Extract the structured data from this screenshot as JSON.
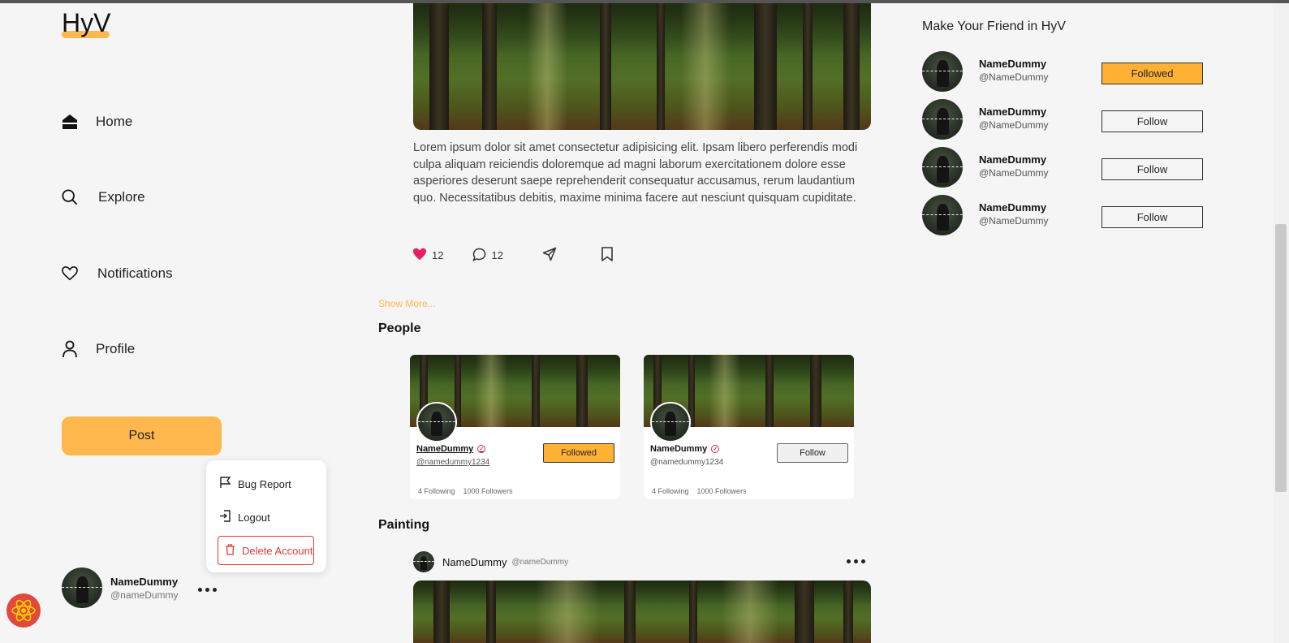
{
  "brand": {
    "logo": "HyV",
    "accent": "#ffb84d"
  },
  "nav": {
    "items": [
      {
        "label": "Home",
        "icon": "home-icon"
      },
      {
        "label": "Explore",
        "icon": "search-icon"
      },
      {
        "label": "Notifications",
        "icon": "heart-icon"
      },
      {
        "label": "Profile",
        "icon": "user-icon"
      }
    ],
    "post_button": "Post"
  },
  "account_menu": {
    "items": [
      {
        "label": "Bug Report",
        "icon": "flag-icon"
      },
      {
        "label": "Logout",
        "icon": "logout-icon"
      },
      {
        "label": "Delete Account",
        "icon": "trash-icon"
      }
    ]
  },
  "current_user": {
    "name": "NameDummy",
    "handle": "@nameDummy"
  },
  "post": {
    "text": "Lorem ipsum dolor sit amet consectetur adipisicing elit. Ipsam libero perferendis modi culpa aliquam reiciendis doloremque ad magni laborum exercitationem dolore esse asperiores deserunt saepe reprehenderit consequatur accusamus, rerum laudantium quo. Necessitatibus debitis, maxime minima facere aut nesciunt quisquam cupiditate.",
    "likes": "12",
    "comments": "12"
  },
  "show_more": "Show More...",
  "people": {
    "title": "People",
    "cards": [
      {
        "name": "NameDummy",
        "handle": "@namedummy1234",
        "following": "4 Following",
        "followers": "1000 Followers",
        "button": "Followed"
      },
      {
        "name": "NameDummy",
        "handle": "@namedummy1234",
        "following": "4 Following",
        "followers": "1000 Followers",
        "button": "Follow"
      }
    ]
  },
  "painting": {
    "title": "Painting",
    "post_author": "NameDummy",
    "post_handle": "@nameDummy"
  },
  "suggestions": {
    "title": "Make Your Friend in HyV",
    "items": [
      {
        "name": "NameDummy",
        "handle": "@NameDummy",
        "button": "Followed"
      },
      {
        "name": "NameDummy",
        "handle": "@NameDummy",
        "button": "Follow"
      },
      {
        "name": "NameDummy",
        "handle": "@NameDummy",
        "button": "Follow"
      },
      {
        "name": "NameDummy",
        "handle": "@NameDummy",
        "button": "Follow"
      }
    ]
  }
}
